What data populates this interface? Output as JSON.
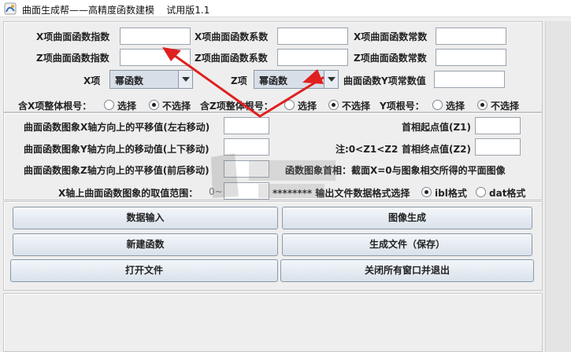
{
  "window": {
    "title": "曲面生成帮——高精度函数建模    试用版1.1"
  },
  "coefficients": {
    "x_exp_label": "X项曲面函数指数",
    "x_exp_value": "",
    "x_coef_label": "X项曲面函数系数",
    "x_coef_value": "",
    "x_const_label": "X项曲面函数常数",
    "x_const_value": "",
    "z_exp_label": "Z项曲面函数指数",
    "z_exp_value": "",
    "z_coef_label": "Z项曲面函数系数",
    "z_coef_value": "",
    "z_const_label": "Z项曲面函数常数",
    "z_const_value": "",
    "x_type_label": "X项",
    "x_type_value": "幂函数",
    "z_type_label": "Z项",
    "z_type_value": "幂函数",
    "y_const_label": "曲面函数Y项常数值",
    "y_const_value": ""
  },
  "radicals": {
    "x_label": "含X项整体根号：",
    "z_label": "含Z项整体根号：",
    "y_label": "Y项根号：",
    "select": "选择",
    "not_select": "不选择"
  },
  "transform": {
    "x_shift_label": "曲面函数图象X轴方向上的平移值(左右移动)",
    "y_shift_label": "曲面函数图象Y轴方向上的移动值(上下移动)",
    "z_shift_label": "曲面函数图象Z轴方向上的平移值(前后移动)",
    "range_label": "X轴上曲面函数图象的取值范围：",
    "range_prefix": "0~",
    "z1_label": "首相起点值(Z1)",
    "z2_label": "首相终点值(Z2)",
    "note": "注:0<Z1<Z2",
    "intercept_note": "函数图象首相：截面X=0与图象相交所得的平面图像",
    "format_label": "******** 输出文件数据格式选择",
    "format_ibl": "ibl格式",
    "format_dat": "dat格式"
  },
  "buttons": {
    "data_input": "数据输入",
    "image_gen": "图像生成",
    "new_func": "新建函数",
    "gen_file": "生成文件（保存）",
    "open_file": "打开文件",
    "close_all": "关闭所有窗口并退出"
  },
  "colors": {
    "arrow": "#e02020",
    "button_face": "#dfe6ee"
  }
}
